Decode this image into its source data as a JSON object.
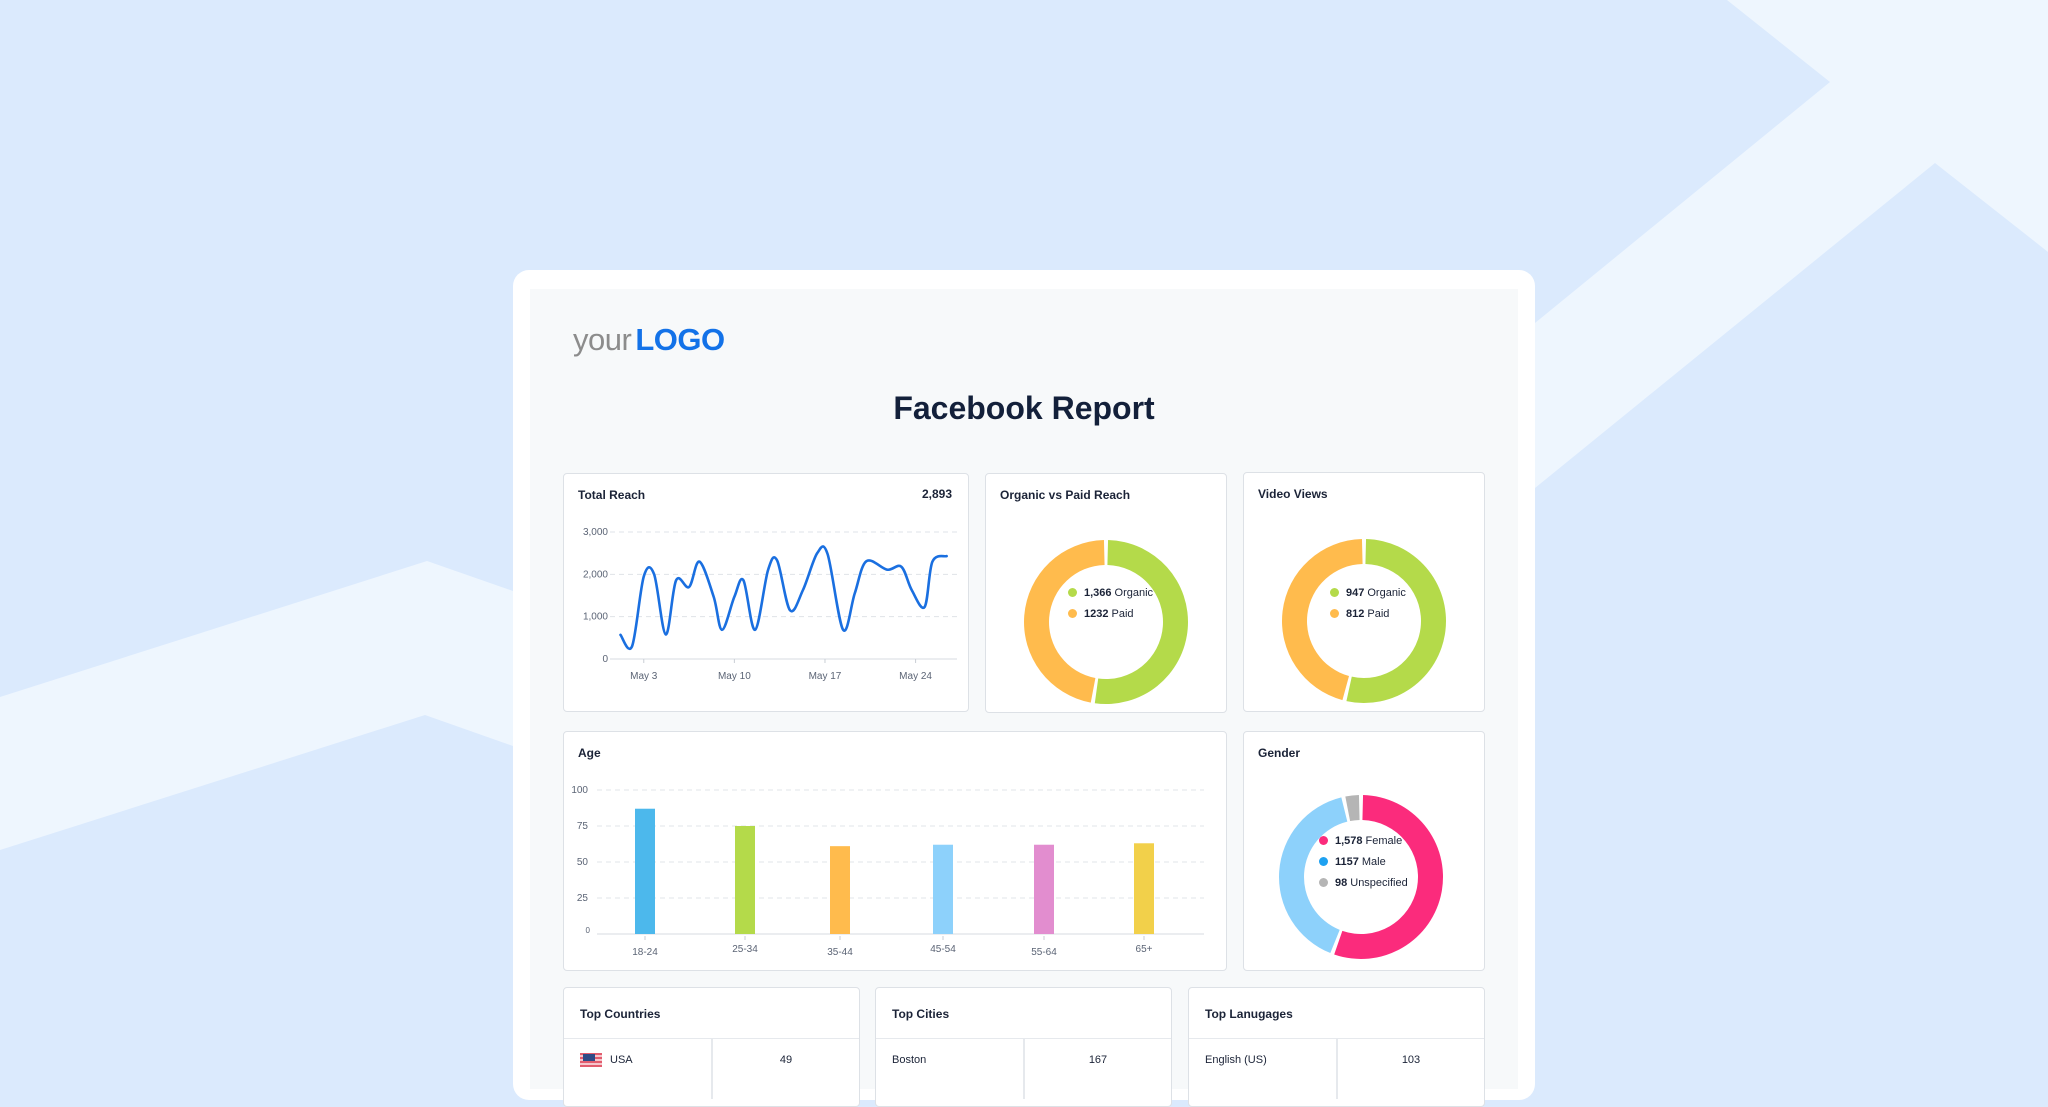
{
  "colors": {
    "background": "#dbeafd",
    "band": "#eef6fe",
    "brand_blue": "#1372e8",
    "line": "#1a6fe0",
    "organic": "#b4da4a",
    "paid": "#ffbb4d",
    "female": "#fb2b7c",
    "male": "#8dd1fb",
    "male_dot": "#1ea1f1",
    "unspecified": "#b5b5b5"
  },
  "logo": {
    "your": "your",
    "brand": "LOGO"
  },
  "report": {
    "title": "Facebook Report"
  },
  "total_reach": {
    "title": "Total Reach",
    "value": "2,893"
  },
  "organic_vs_paid": {
    "title": "Organic vs Paid Reach",
    "legend": [
      {
        "value": "1,366",
        "label": "Organic"
      },
      {
        "value": "1232",
        "label": "Paid"
      }
    ]
  },
  "video_views": {
    "title": "Video Views",
    "legend": [
      {
        "value": "947",
        "label": "Organic"
      },
      {
        "value": "812",
        "label": "Paid"
      }
    ]
  },
  "age": {
    "title": "Age"
  },
  "gender": {
    "title": "Gender",
    "legend": [
      {
        "value": "1,578",
        "label": "Female"
      },
      {
        "value": "1157",
        "label": "Male"
      },
      {
        "value": "98",
        "label": "Unspecified"
      }
    ]
  },
  "top_countries": {
    "title": "Top Countries",
    "rows": [
      {
        "name": "USA",
        "flag": "us-flag-icon",
        "value": "49"
      }
    ]
  },
  "top_cities": {
    "title": "Top Cities",
    "rows": [
      {
        "name": "Boston",
        "value": "167"
      }
    ]
  },
  "top_languages": {
    "title": "Top Lanugages",
    "rows": [
      {
        "name": "English (US)",
        "value": "103"
      }
    ]
  },
  "chart_data": [
    {
      "type": "line",
      "title": "Total Reach",
      "xlabel": "",
      "ylabel": "",
      "x": [
        1.2,
        2.1,
        3.0,
        3.8,
        4.7,
        5.5,
        6.5,
        7.3,
        8.4,
        9.05,
        10.0,
        10.7,
        11.6,
        12.6,
        13.3,
        14.3,
        15.3,
        16.4,
        17.2,
        18.4,
        19.3,
        20.2,
        21.8,
        22.9,
        23.7,
        24.7,
        25.3,
        26.4
      ],
      "series": [
        {
          "name": "Reach",
          "values": [
            570,
            305,
            1950,
            2000,
            580,
            1860,
            1700,
            2300,
            1470,
            690,
            1470,
            1860,
            690,
            2100,
            2330,
            1150,
            1630,
            2500,
            2480,
            690,
            1550,
            2310,
            2110,
            2180,
            1630,
            1230,
            2300,
            2430
          ]
        }
      ],
      "x_ticks": [
        3,
        10,
        17,
        24
      ],
      "x_tick_labels": [
        "May 3",
        "May 10",
        "May 17",
        "May 24"
      ],
      "y_ticks": [
        0,
        1000,
        2000,
        3000
      ],
      "y_tick_labels": [
        "0",
        "1,000",
        "2,000",
        "3,000"
      ],
      "xlim": [
        0.7,
        27.2
      ],
      "ylim": [
        0,
        3000
      ],
      "grid": true
    },
    {
      "type": "pie",
      "title": "Organic vs Paid Reach",
      "categories": [
        "Organic",
        "Paid"
      ],
      "values": [
        1366,
        1232
      ]
    },
    {
      "type": "pie",
      "title": "Video Views",
      "categories": [
        "Organic",
        "Paid"
      ],
      "values": [
        947,
        812
      ]
    },
    {
      "type": "bar",
      "title": "Age",
      "categories": [
        "18-24",
        "25-34",
        "35-44",
        "45-54",
        "55-64",
        "65+"
      ],
      "values": [
        87,
        75,
        61,
        62,
        62,
        63
      ],
      "bar_colors": [
        "#4cb8ec",
        "#b4da4a",
        "#ffbb4d",
        "#8dd1fb",
        "#e28dcf",
        "#f2d04a"
      ],
      "y_ticks": [
        0,
        25,
        50,
        75,
        100
      ],
      "y_tick_labels": [
        "0",
        "25",
        "50",
        "75",
        "100"
      ],
      "ylim": [
        0,
        100
      ],
      "grid": true
    },
    {
      "type": "pie",
      "title": "Gender",
      "categories": [
        "Female",
        "Male",
        "Unspecified"
      ],
      "values": [
        1578,
        1157,
        98
      ]
    }
  ]
}
